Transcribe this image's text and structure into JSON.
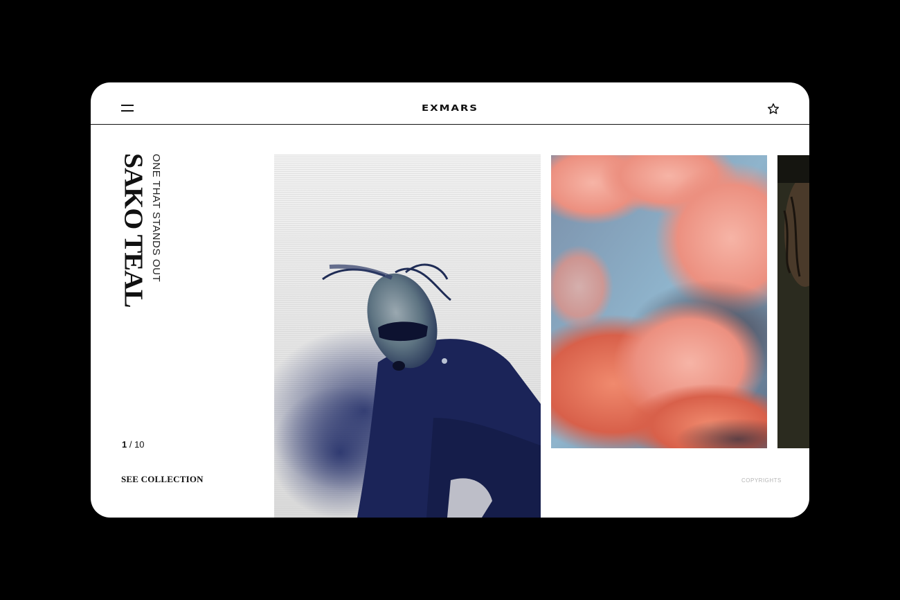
{
  "header": {
    "brand": "EXMARS",
    "menu_icon": "hamburger-menu-icon",
    "favorite_icon": "star-icon"
  },
  "hero": {
    "title": "SAKO TEAL",
    "subtitle": "ONE THAT STANDS OUT"
  },
  "pagination": {
    "current": "1",
    "separator": " / ",
    "total": "10"
  },
  "cta": {
    "label": "SEE COLLECTION"
  },
  "footer": {
    "copyrights": "COPYRIGHTS"
  },
  "gallery": {
    "images": [
      {
        "name": "portrait-photo",
        "palette": [
          "#ececec",
          "#1d2a63",
          "#6f8a97"
        ]
      },
      {
        "name": "clouds-photo",
        "palette": [
          "#f0a090",
          "#89b3cc",
          "#e06b52"
        ]
      },
      {
        "name": "partial-photo",
        "palette": [
          "#2a2a1e",
          "#5a4630"
        ]
      }
    ]
  },
  "colors": {
    "background": "#000000",
    "card": "#ffffff",
    "text": "#111111",
    "muted": "#b5b5b5"
  }
}
